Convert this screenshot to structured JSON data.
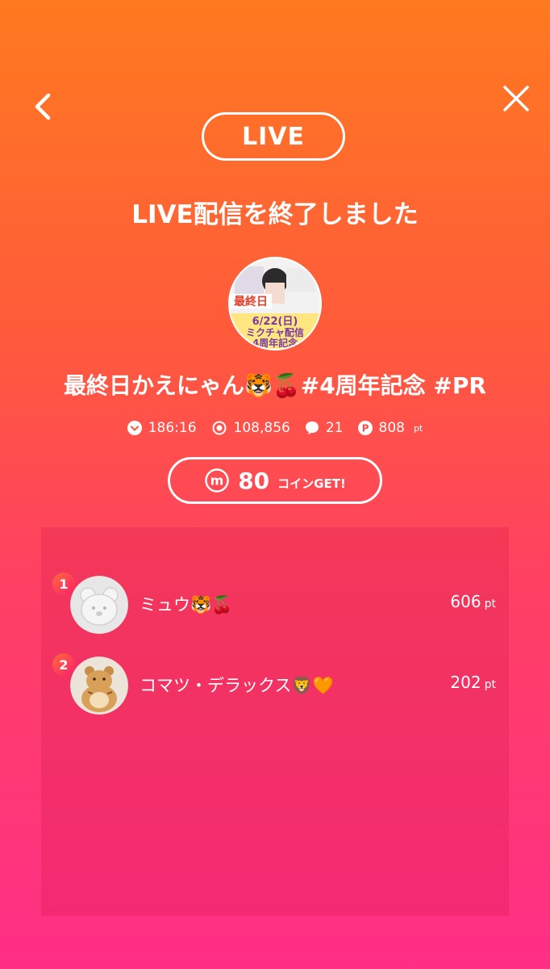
{
  "header": {
    "badge": "LIVE",
    "back_icon": "chevron-left-icon",
    "close_icon": "close-icon"
  },
  "main": {
    "ended_message": "LIVE配信を終了しました",
    "stream_title": "最終日かえにゃん🐯🍒#4周年記念 #PR",
    "thumbnail": {
      "label1": "最終日",
      "label2": "6/22(日)",
      "label3": "ミクチャ配信",
      "label4": "4周年記念"
    },
    "stats": {
      "duration": "186:16",
      "views": "108,856",
      "comments": "21",
      "points": "808",
      "points_unit": "pt"
    },
    "coin": {
      "amount": "80",
      "label": "コインGET!"
    }
  },
  "ranking": [
    {
      "rank": "1",
      "name": "ミュウ🐯🍒",
      "points": "606",
      "unit": "pt"
    },
    {
      "rank": "2",
      "name": "コマツ・デラックス🦁🧡",
      "points": "202",
      "unit": "pt"
    }
  ],
  "colors": {
    "gradient_top": "#ff7a1f",
    "gradient_bottom": "#ff2f86",
    "rank_badge": "#ff1f6a"
  }
}
